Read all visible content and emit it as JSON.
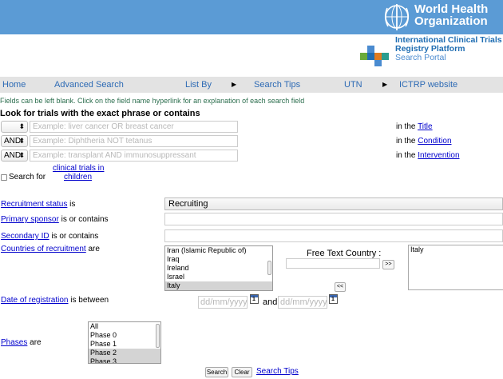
{
  "header": {
    "who_line1": "World Health",
    "who_line2": "Organization",
    "ictrp_line1": "International Clinical Trials",
    "ictrp_line2": "Registry Platform",
    "ictrp_line3": "Search Portal",
    "brand_color": "#5b9bd5"
  },
  "nav": {
    "home": "Home",
    "advanced_search": "Advanced Search",
    "list_by": "List By",
    "search_tips": "Search Tips",
    "utn": "UTN",
    "ictrp_website": "ICTRP website",
    "arrow": "▶"
  },
  "form": {
    "hint": "Fields can be left blank. Click on the field name hyperlink for an explanation of each search field",
    "look_title": "Look for trials with the exact phrase or contains",
    "rows": [
      {
        "op": "",
        "placeholder": "Example: liver cancer OR breast cancer",
        "in_the": "in the ",
        "field_link": "Title"
      },
      {
        "op": "AND",
        "placeholder": "Example: Diphtheria NOT tetanus",
        "in_the": "in the ",
        "field_link": "Condition"
      },
      {
        "op": "AND",
        "placeholder": "Example: transplant AND immunosuppressant",
        "in_the": "in the ",
        "field_link": "Intervention"
      }
    ],
    "children_prefix": "Search for",
    "children_link_1": "clinical trials in",
    "children_link_2": "children",
    "recruitment_link": "Recruitment status",
    "recruitment_suffix": " is",
    "recruitment_value": "Recruiting",
    "sponsor_link": "Primary sponsor",
    "sponsor_suffix": " is or contains",
    "secondary_link": "Secondary ID",
    "secondary_suffix": " is or contains",
    "countries_link": "Countries of recruitment",
    "countries_suffix": " are",
    "countries_options": [
      "Iran (Islamic Republic of)",
      "Iraq",
      "Ireland",
      "Israel",
      "Italy"
    ],
    "countries_selected": "Italy",
    "free_text_country_label": "Free Text Country :",
    "add_button": ">>",
    "remove_button": "<<",
    "selected_countries": [
      "Italy"
    ],
    "date_link": "Date of registration",
    "date_suffix": " is between",
    "date_placeholder": "dd/mm/yyyy",
    "date_and": "and",
    "calendar_glyph": "1",
    "phases_link": "Phases",
    "phases_suffix": " are",
    "phases_options": [
      "All",
      "Phase 0",
      "Phase 1",
      "Phase 2",
      "Phase 3"
    ],
    "phases_selected": "Phase 2",
    "search_button": "Search",
    "clear_button": "Clear",
    "search_tips_link": "Search Tips"
  }
}
